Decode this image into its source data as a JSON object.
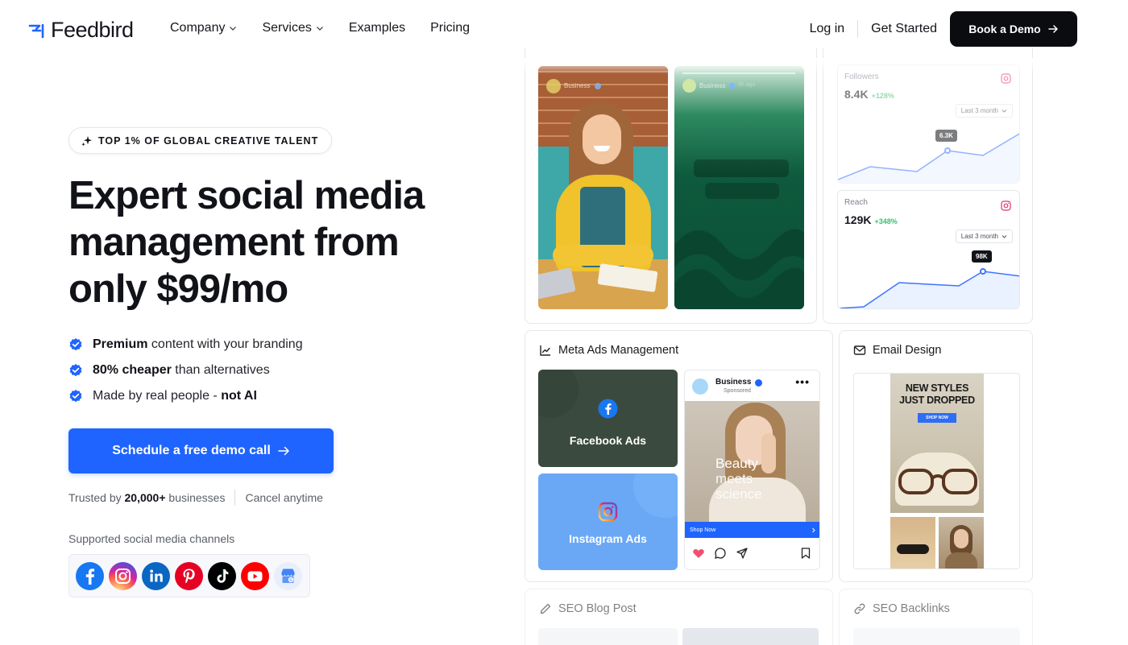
{
  "nav": {
    "brand": "Feedbird",
    "links": [
      {
        "label": "Company",
        "dropdown": true
      },
      {
        "label": "Services",
        "dropdown": true
      },
      {
        "label": "Examples",
        "dropdown": false
      },
      {
        "label": "Pricing",
        "dropdown": false
      }
    ],
    "login": "Log in",
    "get_started": "Get Started",
    "demo_button": "Book a Demo"
  },
  "hero": {
    "badge": "TOP 1% OF GLOBAL CREATIVE TALENT",
    "title_line1": "Expert social media",
    "title_line2": "management from",
    "title_line3": "only $99/mo",
    "bullets": [
      {
        "bold": "Premium",
        "text": " content with your branding"
      },
      {
        "bold": "80% cheaper",
        "text": " than alternatives"
      },
      {
        "text": "Made by real people - ",
        "bold_after": "not AI"
      }
    ],
    "cta": "Schedule a free demo call",
    "trust_prefix": "Trusted by ",
    "trust_count": "20,000+",
    "trust_suffix": " businesses",
    "cancel": "Cancel anytime",
    "channels_label": "Supported social media channels",
    "channels": [
      "facebook-icon",
      "instagram-icon",
      "linkedin-icon",
      "pinterest-icon",
      "tiktok-icon",
      "youtube-icon",
      "google-business-icon"
    ]
  },
  "cards": {
    "post_preview": {
      "account_name_1": "Business",
      "account_name_2": "Business",
      "time_label": "3h ago"
    },
    "followers": {
      "label": "Followers",
      "value": "8.4K",
      "delta": "+128%",
      "range": "Last 3 month",
      "tooltip": "6.3K"
    },
    "reach": {
      "label": "Reach",
      "value": "129K",
      "delta": "+348%",
      "range": "Last 3 month",
      "tooltip": "98K"
    },
    "meta_ads": {
      "title": "Meta Ads Management",
      "facebook_label": "Facebook Ads",
      "instagram_label": "Instagram Ads",
      "post_account": "Business",
      "post_sponsored": "Sponsored",
      "overlay_line1": "Beauty",
      "overlay_line2": "meets",
      "overlay_line3": "science",
      "shop_now": "Shop Now"
    },
    "email_design": {
      "title": "Email Design",
      "headline_1": "NEW STYLES",
      "headline_2": "JUST DROPPED",
      "shop_now": "SHOP NOW"
    },
    "seo_blog": {
      "title": "SEO Blog Post"
    },
    "seo_backlinks": {
      "title": "SEO Backlinks"
    }
  },
  "colors": {
    "accent": "#1f64ff",
    "check": "#1f64ff",
    "dark_green": "#0e5a3e",
    "fb_card": "#3a4a3e",
    "ig_card": "#6aa8f6"
  }
}
